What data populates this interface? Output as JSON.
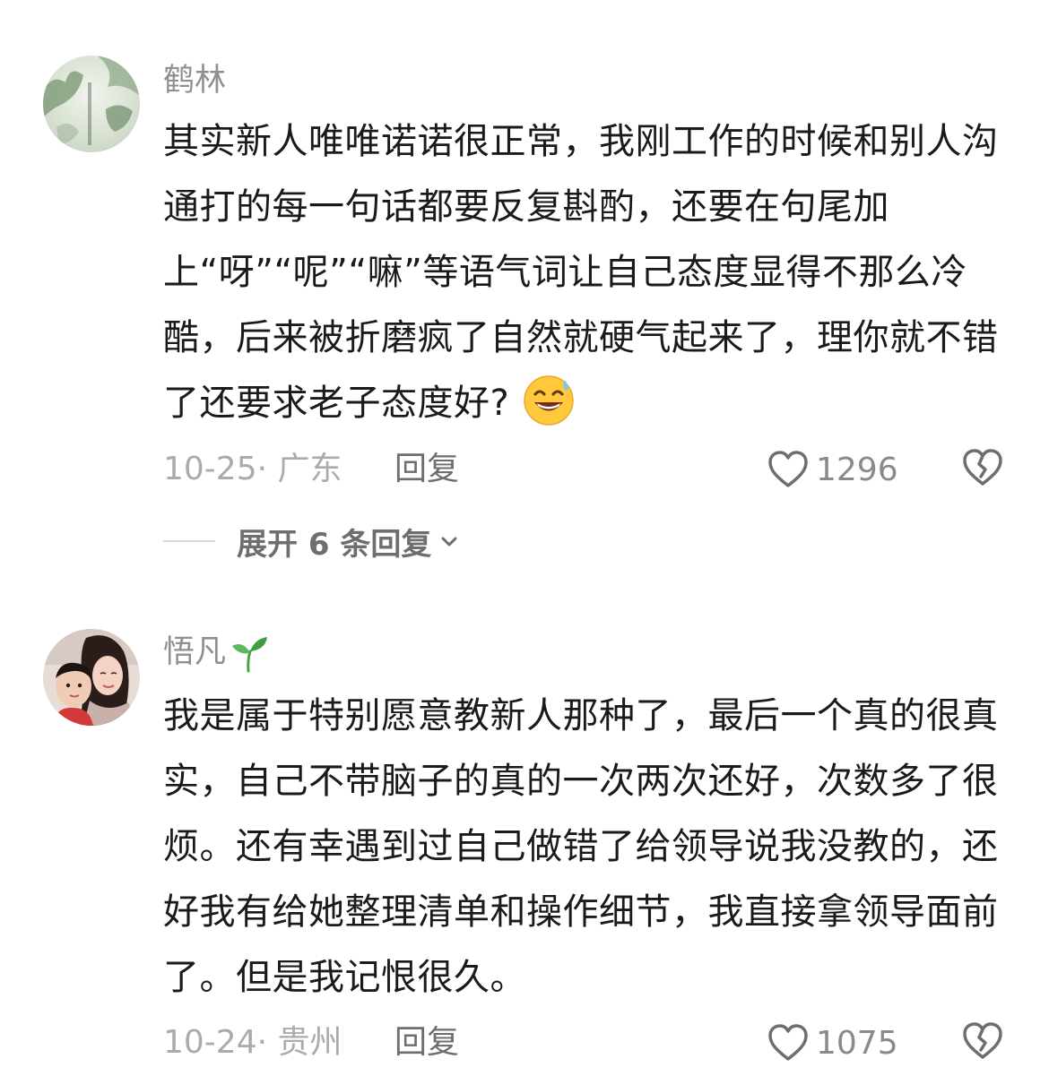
{
  "comments": [
    {
      "username": "鹤林",
      "text": "其实新人唯唯诺诺很正常，我刚工作的时候和别人沟通打的每一句话都要反复斟酌，还要在句尾加上“呀”“呢”“嘛”等语气词让自己态度显得不那么冷酷，后来被折磨疯了自然就硬气起来了，理你就不错了还要求老子态度好?",
      "emoji": "grinning-sweat-emoji",
      "date_location": "10-25· 广东",
      "reply_label": "回复",
      "like_count": "1296",
      "expand_replies_label": "展开 6 条回复"
    },
    {
      "username": "悟凡",
      "username_icon": "sprout-icon",
      "text": "我是属于特别愿意教新人那种了，最后一个真的很真实，自己不带脑子的真的一次两次还好，次数多了很烦。还有幸遇到过自己做错了给领导说我没教的，还好我有给她整理清单和操作细节，我直接拿领导面前了。但是我记恨很久。",
      "date_location": "10-24· 贵州",
      "reply_label": "回复",
      "like_count": "1075"
    }
  ],
  "colors": {
    "username": "#8f8f8f",
    "body_text": "#1a1a1a",
    "meta": "#ababab",
    "action": "#6e6e6e"
  }
}
